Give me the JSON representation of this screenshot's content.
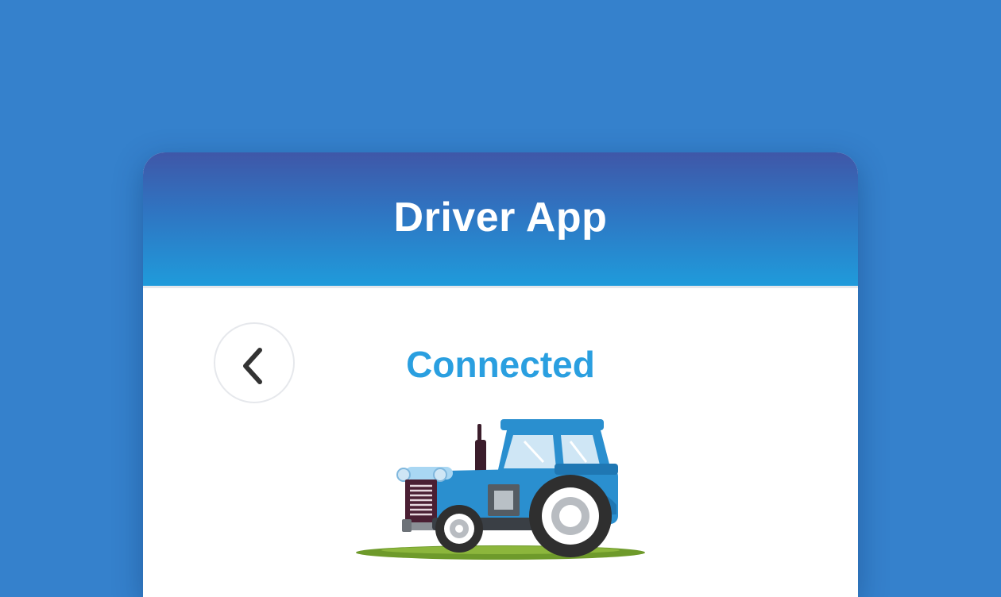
{
  "app": {
    "title": "Driver App"
  },
  "connection": {
    "status_text": "Connected",
    "status_color": "#2a9fe0"
  },
  "navigation": {
    "back_icon": "chevron-left-icon"
  },
  "illustration": {
    "subject": "tractor-icon",
    "body_color": "#2a8fcf"
  },
  "theme": {
    "background": "#3581cc",
    "header_gradient_top": "#3f57a8",
    "header_gradient_bottom": "#1f9bdb"
  }
}
